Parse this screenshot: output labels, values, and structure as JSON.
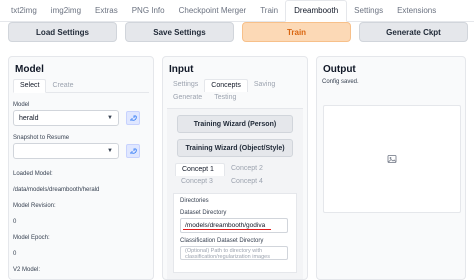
{
  "nav": {
    "tabs": [
      "txt2img",
      "img2img",
      "Extras",
      "PNG Info",
      "Checkpoint Merger",
      "Train",
      "Dreambooth",
      "Settings",
      "Extensions"
    ],
    "active": "Dreambooth"
  },
  "actions": {
    "load": "Load Settings",
    "save": "Save Settings",
    "train": "Train",
    "generate": "Generate Ckpt"
  },
  "model": {
    "title": "Model",
    "tabs": [
      "Select",
      "Create"
    ],
    "model_label": "Model",
    "model_value": "herald",
    "snapshot_label": "Snapshot to Resume",
    "snapshot_value": "",
    "loaded_label": "Loaded Model:",
    "loaded_value": "/data/models/dreambooth/herald",
    "revision_label": "Model Revision:",
    "revision_value": "0",
    "epoch_label": "Model Epoch:",
    "epoch_value": "0",
    "v2_label": "V2 Model:"
  },
  "input": {
    "title": "Input",
    "tabs_row1": [
      "Settings",
      "Concepts",
      "Saving"
    ],
    "tabs_row2": [
      "Generate",
      "Testing"
    ],
    "wizard_person": "Training Wizard (Person)",
    "wizard_object": "Training Wizard (Object/Style)",
    "concepts": [
      "Concept 1",
      "Concept 2",
      "Concept 3",
      "Concept 4"
    ],
    "directories_label": "Directories",
    "dataset_label": "Dataset Directory",
    "dataset_value": "/models/dreambooth/godiva",
    "class_label": "Classification Dataset Directory",
    "class_placeholder": "(Optional) Path to directory with classification/regularization images"
  },
  "output": {
    "title": "Output",
    "status": "Config saved."
  },
  "colors": {
    "accent": "#d9650f",
    "train_bg": "#fcd9b6",
    "highlight_line": "#e11d1d"
  }
}
